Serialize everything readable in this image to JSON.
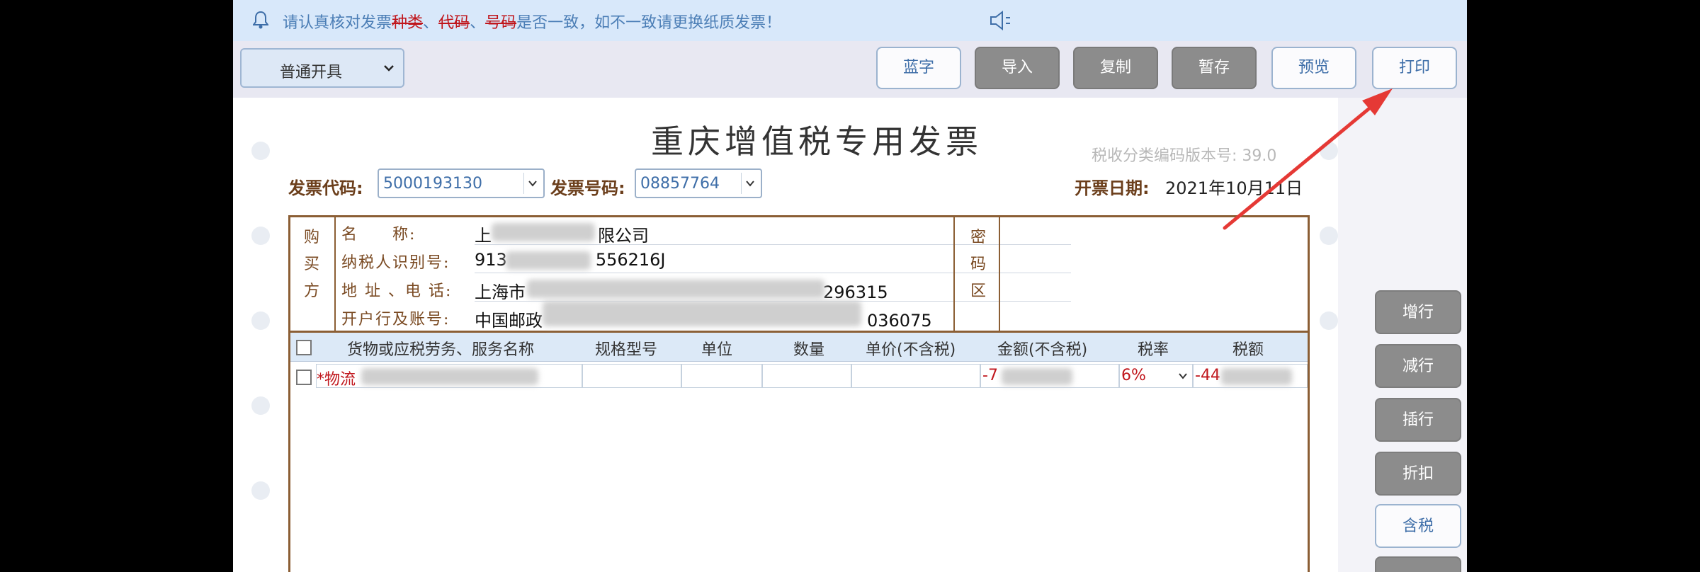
{
  "notice": {
    "prefix": "请认真核对发票",
    "kind": "种类",
    "sep1": "、",
    "code": "代码",
    "sep2": "、",
    "number": "号码",
    "suffix": "是否一致，如不一致请更换纸质发票！"
  },
  "toolbar": {
    "mode": "普通开具",
    "buttons": {
      "blue": "蓝字",
      "import": "导入",
      "copy": "复制",
      "save_draft": "暂存",
      "preview": "预览",
      "print": "打印"
    }
  },
  "invoice": {
    "title": "重庆增值税专用发票",
    "tax_code_version": "税收分类编码版本号: 39.0",
    "code_label": "发票代码:",
    "code_value": "5000193130",
    "number_label": "发票号码:",
    "number_value": "08857764",
    "date_label": "开票日期:",
    "date_value": "2021年10月11日"
  },
  "buyer": {
    "side_label": [
      "购",
      "买",
      "方"
    ],
    "password_label": [
      "密",
      "码",
      "区"
    ],
    "rows": [
      {
        "label": "名　　称:",
        "value_start": "上",
        "value_end": "限公司"
      },
      {
        "label": "纳税人识别号:",
        "value_start": "913",
        "value_end": "556216J"
      },
      {
        "label": "地 址 、电 话:",
        "value_start": "上海市",
        "value_end": "296315"
      },
      {
        "label": "开户行及账号:",
        "value_start": "中国邮政",
        "value_end": "036075"
      }
    ]
  },
  "goods": {
    "headers": [
      "货物或应税劳务、服务名称",
      "规格型号",
      "单位",
      "数量",
      "单价(不含税)",
      "金额(不含税)",
      "税率",
      "税额"
    ],
    "row": {
      "name": "*物流",
      "amount": "-7",
      "rate": "6%",
      "tax": "-44"
    }
  },
  "side_buttons": {
    "add_row": "增行",
    "remove_row": "减行",
    "insert_row": "插行",
    "discount": "折扣",
    "tax_included": "含税"
  },
  "colors": {
    "accent_blue": "#3e6ea8",
    "label_brown": "#6b3e1b",
    "notice_red": "#c0161c",
    "annotation_arrow": "#e53935"
  }
}
